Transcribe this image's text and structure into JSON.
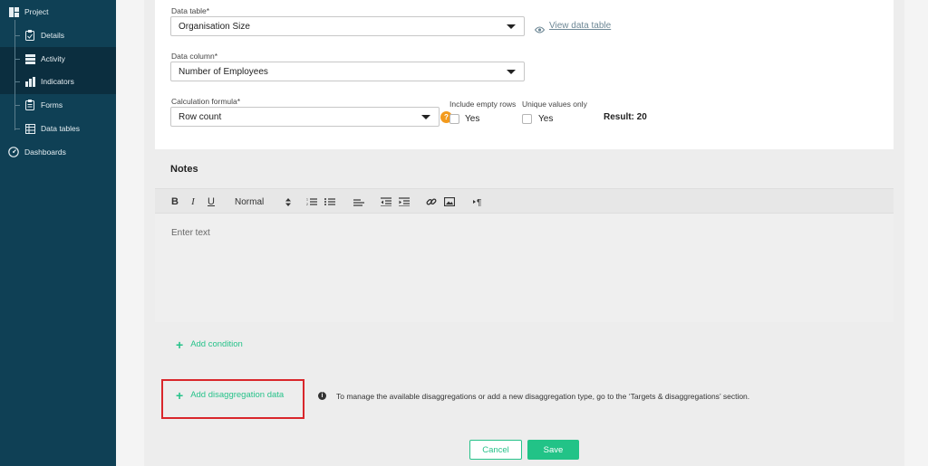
{
  "sidebar": {
    "items": [
      {
        "label": "Project",
        "icon": "project-icon"
      },
      {
        "label": "Details",
        "icon": "clipboard-icon"
      },
      {
        "label": "Activity",
        "icon": "server-icon"
      },
      {
        "label": "Indicators",
        "icon": "bar-chart-icon"
      },
      {
        "label": "Forms",
        "icon": "form-icon"
      },
      {
        "label": "Data tables",
        "icon": "table-icon"
      },
      {
        "label": "Dashboards",
        "icon": "gauge-icon"
      }
    ]
  },
  "form": {
    "data_table": {
      "label": "Data table*",
      "value": "Organisation Size",
      "view_link": "View data table"
    },
    "data_column": {
      "label": "Data column*",
      "value": "Number of Employees"
    },
    "calc_formula": {
      "label": "Calculation formula*",
      "value": "Row count"
    },
    "include_empty": {
      "label": "Include empty rows",
      "option": "Yes"
    },
    "unique_values": {
      "label": "Unique values only",
      "option": "Yes"
    },
    "result": "Result: 20",
    "help_glyph": "?"
  },
  "notes": {
    "title": "Notes",
    "toolbar": {
      "bold": "B",
      "italic": "I",
      "underline": "U",
      "style": "Normal"
    },
    "placeholder": "Enter text"
  },
  "actions": {
    "add_condition": "Add condition",
    "add_disaggregation": "Add disaggregation data",
    "info_text": "To manage the available disaggregations or add a new disaggregation type, go to the ‘Targets & disaggregations’ section.",
    "cancel": "Cancel",
    "save": "Save"
  },
  "colors": {
    "sidebar": "#0f4055",
    "accent": "#27c28a",
    "help": "#f39a1c",
    "highlight": "#d9262b"
  }
}
